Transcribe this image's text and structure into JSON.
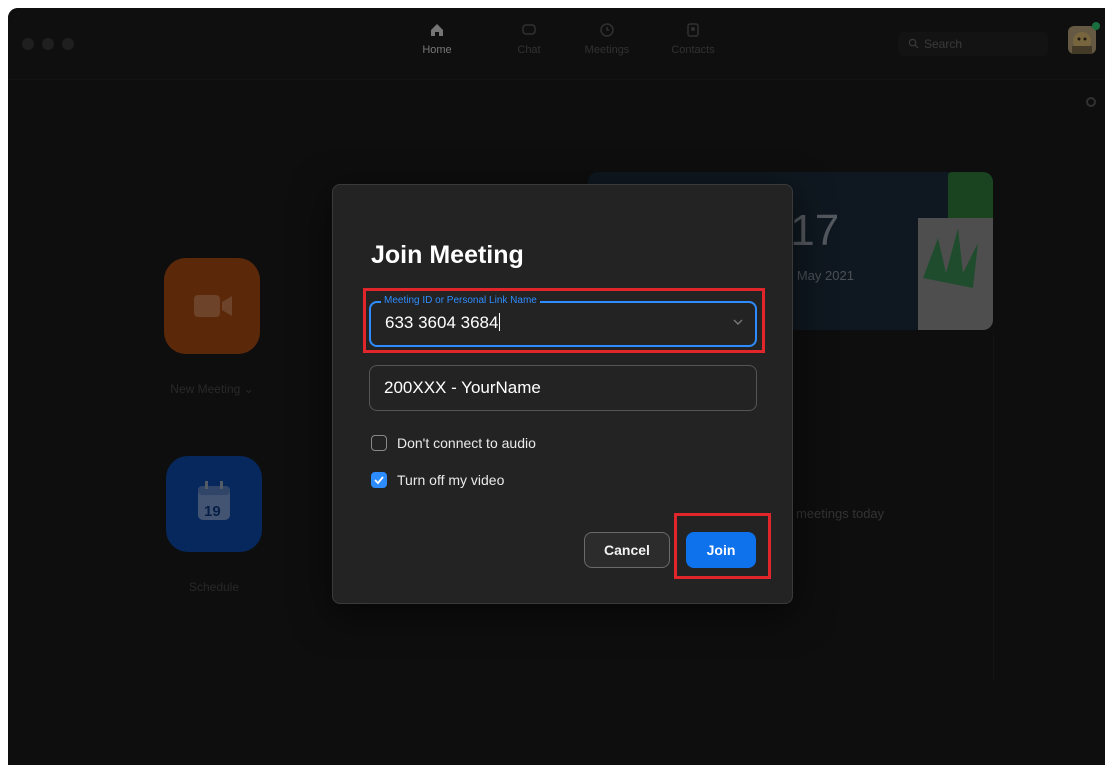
{
  "nav": {
    "items": [
      {
        "label": "Home",
        "icon": "home-icon"
      },
      {
        "label": "Chat",
        "icon": "chat-icon"
      },
      {
        "label": "Meetings",
        "icon": "clock-icon"
      },
      {
        "label": "Contacts",
        "icon": "contacts-icon"
      }
    ],
    "search_placeholder": "Search"
  },
  "home": {
    "new_meeting_label": "New Meeting ⌄",
    "schedule_label": "Schedule",
    "calendar_day": "19",
    "clock_time": ":17",
    "clock_date": "0 May 2021",
    "no_meetings_text": "meetings today"
  },
  "dialog": {
    "title": "Join Meeting",
    "meeting_id_legend": "Meeting ID or Personal Link Name",
    "meeting_id_value": "633 3604 3684",
    "name_value": "200XXX - YourName",
    "options": [
      {
        "label": "Don't connect to audio",
        "checked": false
      },
      {
        "label": "Turn off my video",
        "checked": true
      }
    ],
    "cancel_label": "Cancel",
    "join_label": "Join"
  },
  "colors": {
    "accent": "#0e72ed",
    "focus": "#2d8cff",
    "highlight": "#e0262a"
  }
}
